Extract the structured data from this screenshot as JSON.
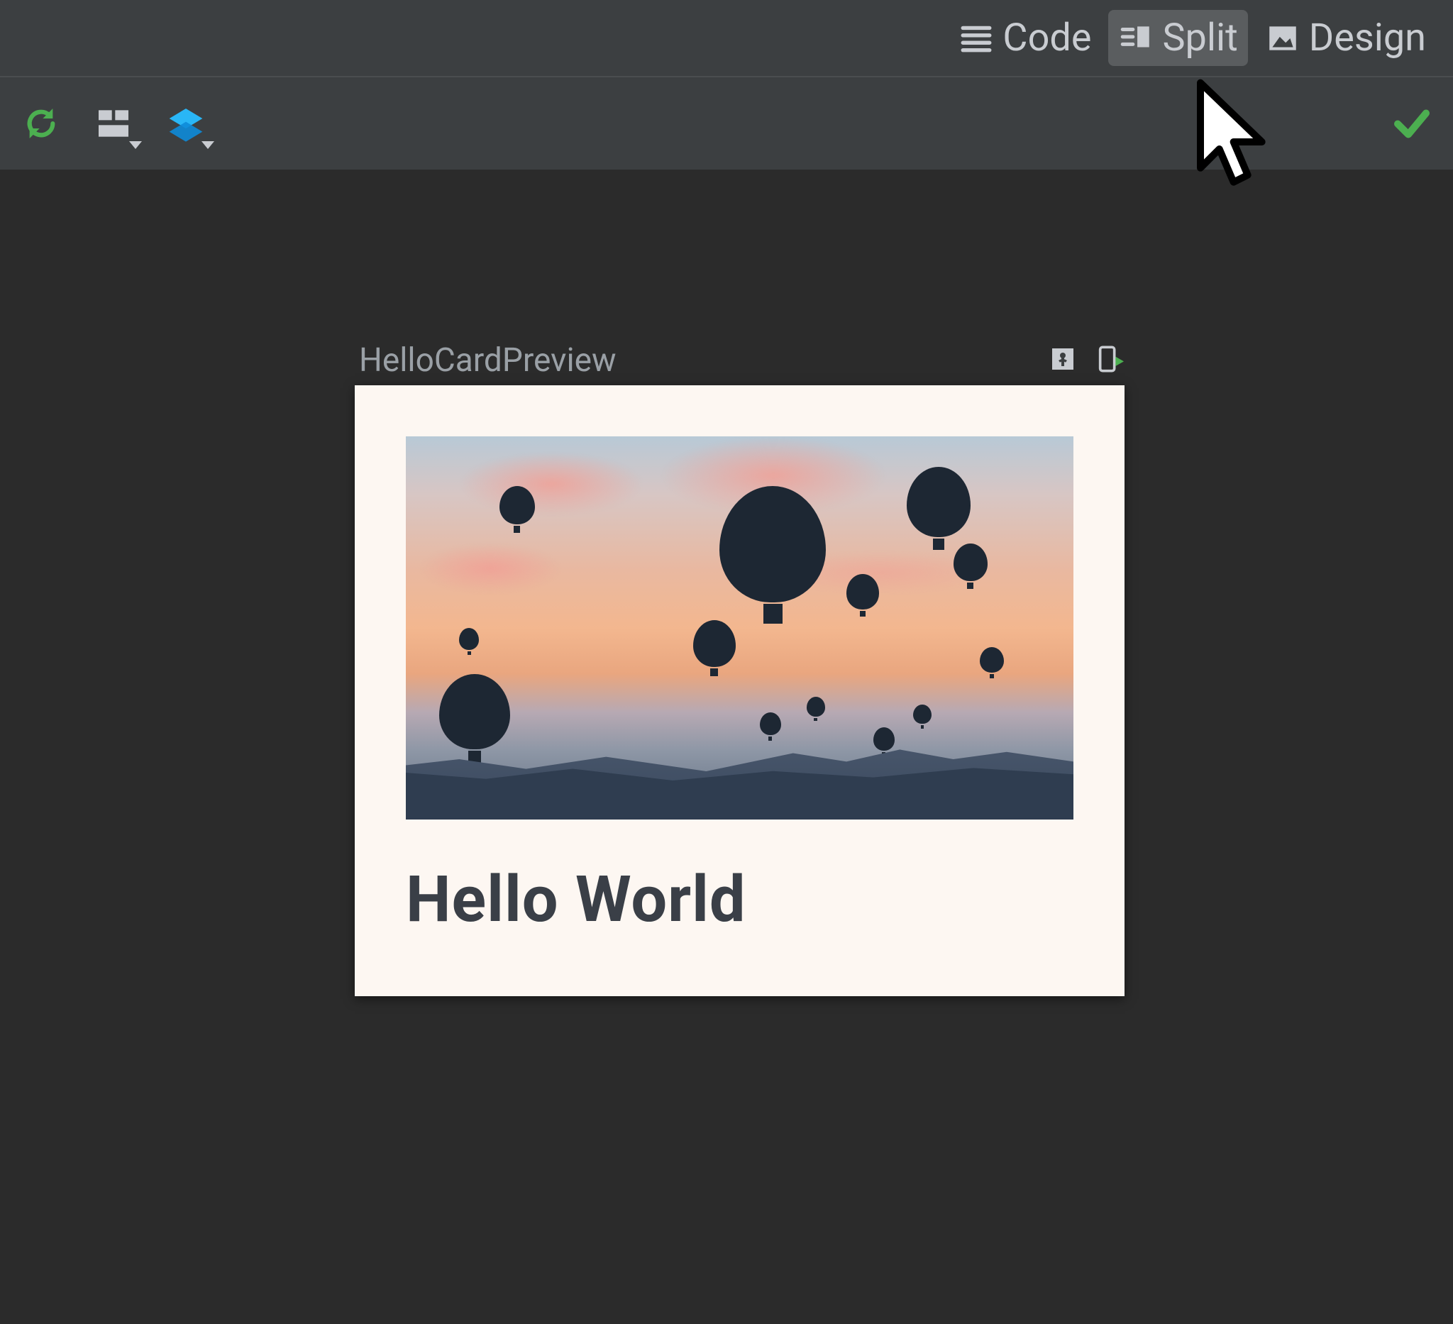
{
  "viewmodes": {
    "code": {
      "label": "Code",
      "selected": false
    },
    "split": {
      "label": "Split",
      "selected": true
    },
    "design": {
      "label": "Design",
      "selected": false
    }
  },
  "toolbar": {
    "refresh_icon": "refresh-icon",
    "layout_icon": "layout-bounds-icon",
    "layers_icon": "layers-icon",
    "status_ok_icon": "checkmark-icon"
  },
  "preview": {
    "title": "HelloCardPreview",
    "interactive_icon": "interactive-preview-icon",
    "deploy_icon": "deploy-preview-icon",
    "card": {
      "headline": "Hello World",
      "image_desc": "sunset-hot-air-balloons"
    }
  }
}
